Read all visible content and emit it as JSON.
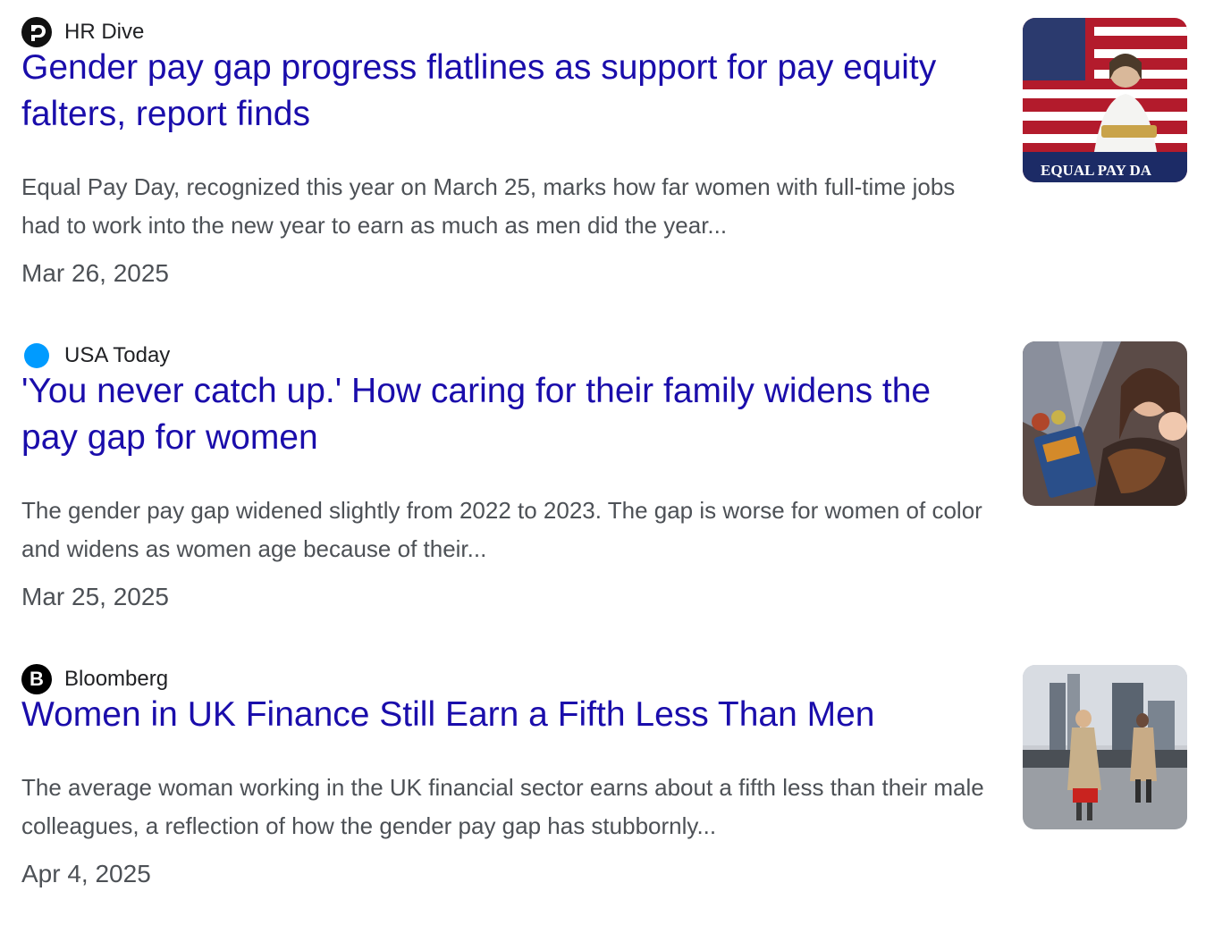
{
  "articles": [
    {
      "source": "HR Dive",
      "source_icon": "hr-dive-logo-icon",
      "title": "Gender pay gap progress flatlines as support for pay equity falters, report finds",
      "snippet": "Equal Pay Day, recognized this year on March 25, marks how far women with full-time jobs had to work into the new year to earn as much as men did the year...",
      "date": "Mar 26, 2025",
      "thumb_caption": "EQUAL PAY DA"
    },
    {
      "source": "USA Today",
      "source_icon": "usa-today-dot-icon",
      "title": "'You never catch up.' How caring for their family widens the pay gap for women",
      "snippet": "The gender pay gap widened slightly from 2022 to 2023. The gap is worse for women of color and widens as women age because of their...",
      "date": "Mar 25, 2025"
    },
    {
      "source": "Bloomberg",
      "source_icon": "bloomberg-logo-icon",
      "source_icon_letter": "B",
      "title": "Women in UK Finance Still Earn a Fifth Less Than Men",
      "snippet": "The average woman working in the UK financial sector earns about a fifth less than their male colleagues, a reflection of how the gender pay gap has stubbornly...",
      "date": "Apr 4, 2025"
    }
  ],
  "colors": {
    "title": "#1a0dab",
    "snippet": "#4d5156",
    "source": "#202124",
    "usa_today": "#009bff"
  }
}
